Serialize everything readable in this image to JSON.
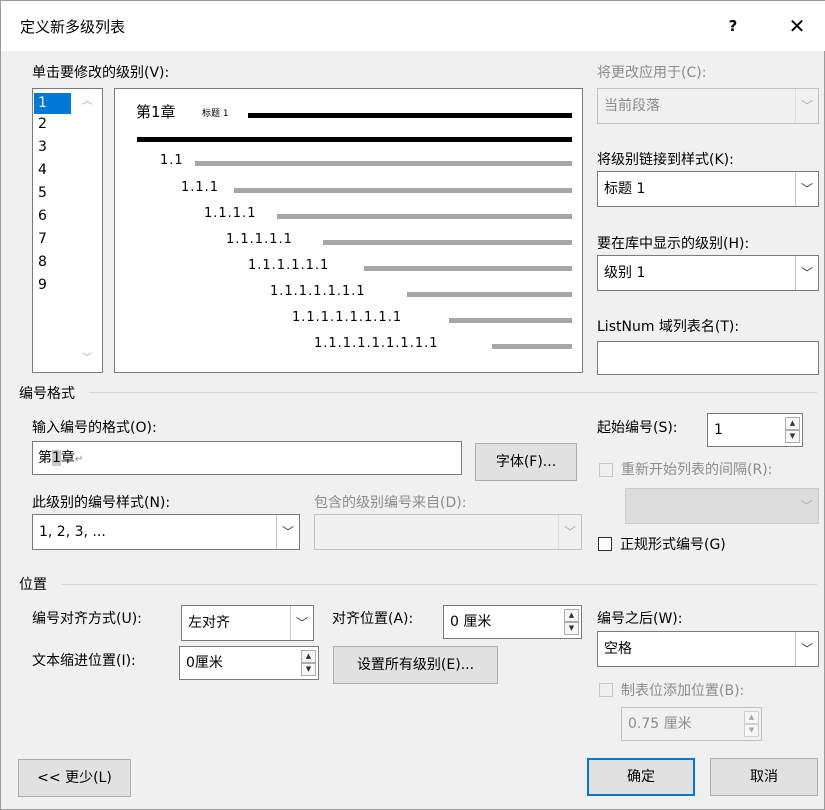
{
  "window": {
    "title": "定义新多级列表",
    "help_label": "?",
    "close_label": "✕"
  },
  "level_section": {
    "label": "单击要修改的级别(V):",
    "levels": [
      "1",
      "2",
      "3",
      "4",
      "5",
      "6",
      "7",
      "8",
      "9"
    ],
    "selected": "1"
  },
  "preview": {
    "heading_number": "第1章",
    "heading_style": "标题 1",
    "numbers": [
      "1.1",
      "1.1.1",
      "1.1.1.1",
      "1.1.1.1.1",
      "1.1.1.1.1.1",
      "1.1.1.1.1.1.1",
      "1.1.1.1.1.1.1.1",
      "1.1.1.1.1.1.1.1.1"
    ]
  },
  "apply_to": {
    "label": "将更改应用于(C):",
    "value": "当前段落"
  },
  "link_style": {
    "label": "将级别链接到样式(K):",
    "value": "标题 1"
  },
  "gallery_level": {
    "label": "要在库中显示的级别(H):",
    "value": "级别 1"
  },
  "listnum": {
    "label": "ListNum 域列表名(T):",
    "value": ""
  },
  "number_format": {
    "section_label": "编号格式",
    "format_label": "输入编号的格式(O):",
    "format_prefix": "第",
    "format_field": "1",
    "format_suffix": "章",
    "font_button": "字体(F)...",
    "style_label": "此级别的编号样式(N):",
    "style_value": "1, 2, 3, ...",
    "include_label": "包含的级别编号来自(D):",
    "include_value": "",
    "start_label": "起始编号(S):",
    "start_value": "1",
    "restart_label": "重新开始列表的间隔(R):",
    "restart_value": "",
    "legal_label": "正规形式编号(G)"
  },
  "position": {
    "section_label": "位置",
    "align_label": "编号对齐方式(U):",
    "align_value": "左对齐",
    "align_at_label": "对齐位置(A):",
    "align_at_value": "0 厘米",
    "indent_label": "文本缩进位置(I):",
    "indent_value": "0厘米",
    "set_all_button": "设置所有级别(E)...",
    "follow_label": "编号之后(W):",
    "follow_value": "空格",
    "tab_label": "制表位添加位置(B):",
    "tab_value": "0.75 厘米"
  },
  "footer": {
    "less_button": "<< 更少(L)",
    "ok_button": "确定",
    "cancel_button": "取消"
  },
  "colors": {
    "accent": "#0078d7",
    "dialog_bg": "#f0f0f0",
    "disabled_text": "#8c8c8c"
  }
}
